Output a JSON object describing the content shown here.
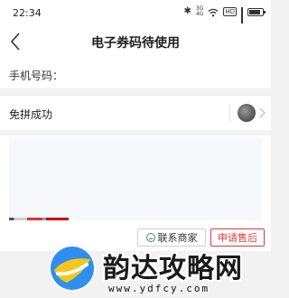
{
  "status_bar": {
    "time": "22:34",
    "net_top": "3G",
    "net_bottom": "4G",
    "hd_label": "HD",
    "battery_level": 0.85
  },
  "nav": {
    "title": "电子券码待使用"
  },
  "phone_row": {
    "label": "手机号码："
  },
  "group_row": {
    "label": "免拼成功"
  },
  "actions": {
    "contact_label": "联系商家",
    "refund_label": "申请售后"
  },
  "watermark": {
    "text": "韵达攻略网",
    "url": "www.ydfcy.com"
  },
  "colors": {
    "accent_red": "#e03a3a",
    "contact_green": "#2a9d4a"
  }
}
